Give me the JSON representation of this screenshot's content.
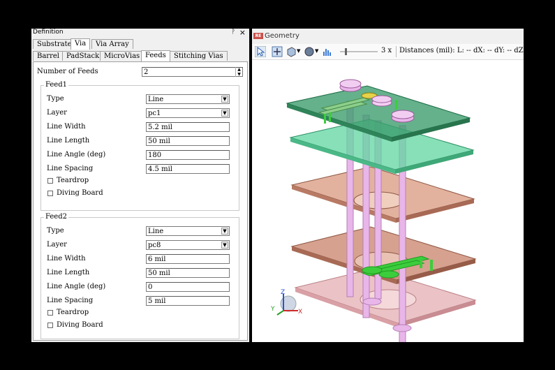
{
  "panel": {
    "title": "Definition",
    "pin": "ᚹ",
    "close": "×",
    "tabs_row1": [
      "Substrate",
      "Via",
      "Via Array"
    ],
    "tabs_row2": [
      "Barrel",
      "PadStack",
      "MicroVias",
      "Feeds",
      "Stitching Vias"
    ],
    "num_feeds_label": "Number of Feeds",
    "num_feeds_value": "2",
    "feed1": {
      "legend": "Feed1",
      "type_label": "Type",
      "type_value": "Line",
      "layer_label": "Layer",
      "layer_value": "pc1",
      "width_label": "Line Width",
      "width_value": "5.2 mil",
      "length_label": "Line Length",
      "length_value": "50 mil",
      "angle_label": "Line Angle (deg)",
      "angle_value": "180",
      "spacing_label": "Line Spacing",
      "spacing_value": "4.5 mil",
      "teardrop_label": "Teardrop",
      "diving_label": "Diving Board"
    },
    "feed2": {
      "legend": "Feed2",
      "type_label": "Type",
      "type_value": "Line",
      "layer_label": "Layer",
      "layer_value": "pc8",
      "width_label": "Line Width",
      "width_value": "6 mil",
      "length_label": "Line Length",
      "length_value": "50 mil",
      "angle_label": "Line Angle (deg)",
      "angle_value": "0",
      "spacing_label": "Line Spacing",
      "spacing_value": "5 mil",
      "teardrop_label": "Teardrop",
      "diving_label": "Diving Board"
    }
  },
  "geometry": {
    "title": "Geometry",
    "logo": "RE",
    "zoom": "3 x",
    "distances": "Distances (mil): L: -- dX: -- dY: -- dZ: --",
    "axes": {
      "z": "Z",
      "y": "Y",
      "x": "X"
    }
  },
  "colors": {
    "top_plane": "#3d9e6e",
    "green_plane": "#5fd6a0",
    "copper_plane": "#c8826a",
    "bottom_plane": "#e6b4b8",
    "via": "#e9b6e9",
    "trace": "#3ccd3c"
  }
}
